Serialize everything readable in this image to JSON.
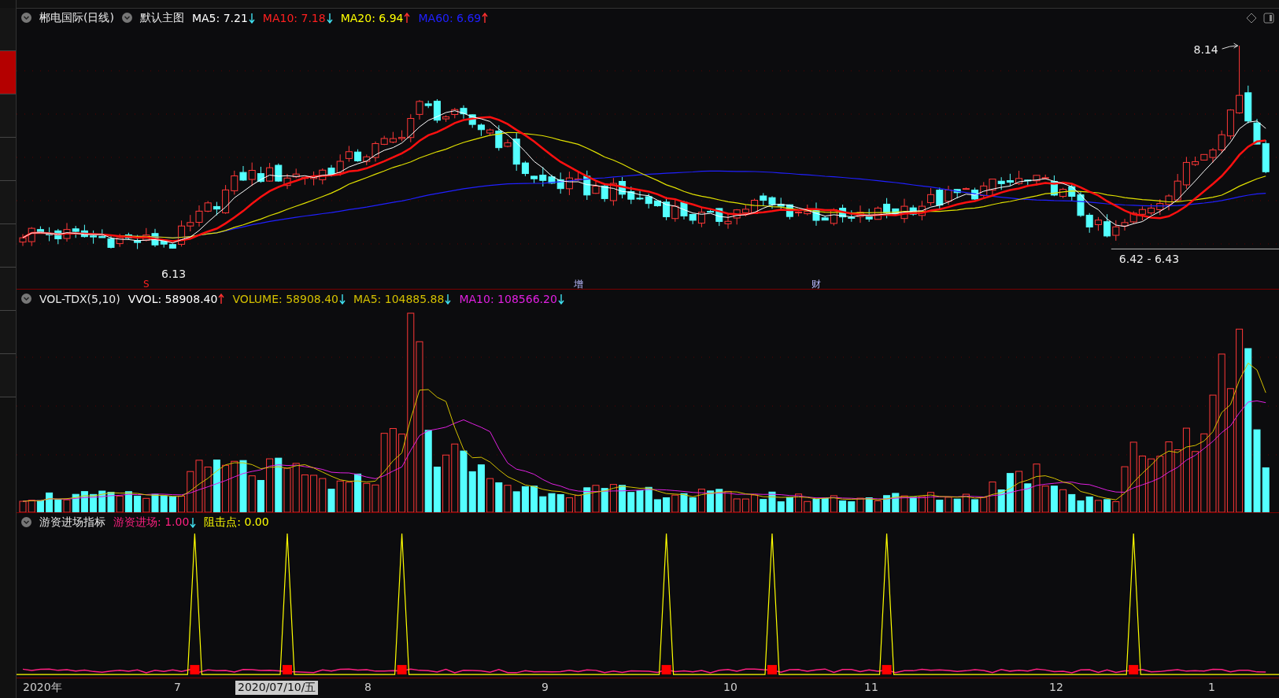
{
  "side_tabs": [
    {
      "selected": false
    },
    {
      "selected": true
    },
    {
      "selected": false
    },
    {
      "selected": false
    },
    {
      "selected": false
    },
    {
      "selected": false
    },
    {
      "selected": false
    },
    {
      "selected": false
    },
    {
      "selected": false
    }
  ],
  "main_panel": {
    "title": "郴电国际(日线)",
    "template": "默认主图",
    "indicators": [
      {
        "label": "MA5: 7.21",
        "color": "#ffffff",
        "rising": false
      },
      {
        "label": "MA10: 7.18",
        "color": "#ff2020",
        "rising": false
      },
      {
        "label": "MA20: 6.94",
        "color": "#ffff00",
        "rising": true
      },
      {
        "label": "MA60: 6.69",
        "color": "#2020ff",
        "rising": true
      }
    ],
    "annotations": [
      {
        "kind": "high",
        "text": "8.14"
      },
      {
        "kind": "low",
        "text": "6.13"
      },
      {
        "kind": "range",
        "text": "6.42 - 6.43"
      }
    ],
    "markers": [
      {
        "kind": "signal",
        "text": "S"
      },
      {
        "kind": "event",
        "text": "增"
      },
      {
        "kind": "event",
        "text": "财"
      }
    ]
  },
  "volume_panel": {
    "title": "VOL-TDX(5,10)",
    "indicators": [
      {
        "label": "VVOL: 58908.40",
        "color": "#ffffff",
        "rising": true
      },
      {
        "label": "VOLUME: 58908.40",
        "color": "#d4c000",
        "rising": false
      },
      {
        "label": "MA5: 104885.88",
        "color": "#d4c000",
        "rising": false
      },
      {
        "label": "MA10: 108566.20",
        "color": "#e020e0",
        "rising": false
      }
    ]
  },
  "indicator_panel": {
    "title": "游资进场指标",
    "indicators": [
      {
        "label": "游资进场: 1.00",
        "color": "#ff2080",
        "rising": false
      },
      {
        "label": "阻击点: 0.00",
        "color": "#ffff00"
      }
    ]
  },
  "x_axis": {
    "labels": [
      {
        "text": "2020年",
        "selected": false
      },
      {
        "text": "7",
        "selected": false
      },
      {
        "text": "2020/07/10/五",
        "selected": true
      },
      {
        "text": "8",
        "selected": false
      },
      {
        "text": "9",
        "selected": false
      },
      {
        "text": "10",
        "selected": false
      },
      {
        "text": "11",
        "selected": false
      },
      {
        "text": "12",
        "selected": false
      },
      {
        "text": "1",
        "selected": false
      }
    ]
  }
}
